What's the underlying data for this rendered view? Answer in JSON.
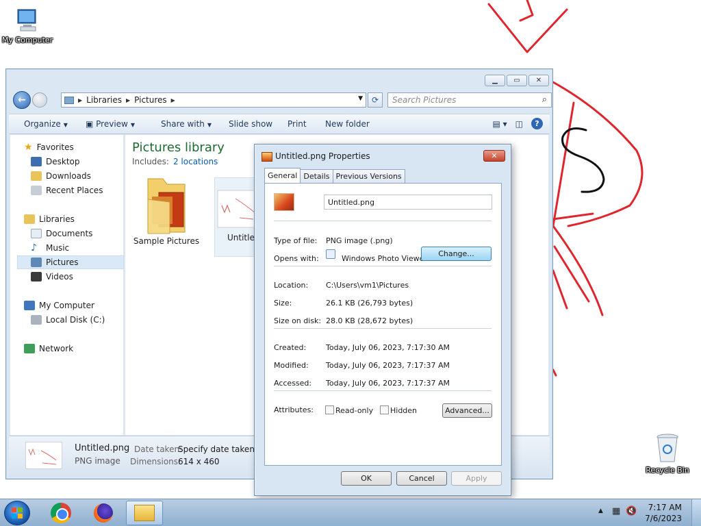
{
  "desktop": {
    "icons": [
      {
        "label": "My Computer"
      },
      {
        "label": "Recycle Bin"
      }
    ],
    "drawing_color": "#e0262c"
  },
  "explorer": {
    "address": [
      "Libraries",
      "Pictures"
    ],
    "search_placeholder": "Search Pictures",
    "toolbar": {
      "organize": "Organize",
      "preview": "Preview",
      "share_with": "Share with",
      "slide_show": "Slide show",
      "print": "Print",
      "new_folder": "New folder"
    },
    "nav": {
      "favorites": "Favorites",
      "desktop": "Desktop",
      "downloads": "Downloads",
      "recent_places": "Recent Places",
      "libraries": "Libraries",
      "documents": "Documents",
      "music": "Music",
      "pictures": "Pictures",
      "videos": "Videos",
      "my_computer": "My Computer",
      "local_disk": "Local Disk (C:)",
      "network": "Network"
    },
    "content": {
      "title": "Pictures library",
      "includes_label": "Includes:",
      "locations_link": "2 locations",
      "items": [
        {
          "label": "Sample Pictures"
        },
        {
          "label": "Untitled"
        }
      ]
    },
    "details": {
      "name": "Untitled.png",
      "type": "PNG image",
      "date_taken_label": "Date taken:",
      "date_taken_value": "Specify date taken",
      "dimensions_label": "Dimensions:",
      "dimensions_value": "614 x 460"
    }
  },
  "properties": {
    "title": "Untitled.png Properties",
    "tabs": [
      "General",
      "Details",
      "Previous Versions"
    ],
    "filename": "Untitled.png",
    "type_label": "Type of file:",
    "type_value": "PNG image (.png)",
    "opens_label": "Opens with:",
    "opens_value": "Windows Photo Viewer",
    "change_button": "Change...",
    "location_label": "Location:",
    "location_value": "C:\\Users\\vm1\\Pictures",
    "size_label": "Size:",
    "size_value": "26.1 KB (26,793 bytes)",
    "size_on_disk_label": "Size on disk:",
    "size_on_disk_value": "28.0 KB (28,672 bytes)",
    "created_label": "Created:",
    "created_value": "Today, July 06, 2023, 7:17:30 AM",
    "modified_label": "Modified:",
    "modified_value": "Today, July 06, 2023, 7:17:37 AM",
    "accessed_label": "Accessed:",
    "accessed_value": "Today, July 06, 2023, 7:17:37 AM",
    "attributes_label": "Attributes:",
    "readonly_label": "Read-only",
    "hidden_label": "Hidden",
    "advanced_button": "Advanced...",
    "ok_button": "OK",
    "cancel_button": "Cancel",
    "apply_button": "Apply"
  },
  "taskbar": {
    "time": "7:17 AM",
    "date": "7/6/2023"
  }
}
